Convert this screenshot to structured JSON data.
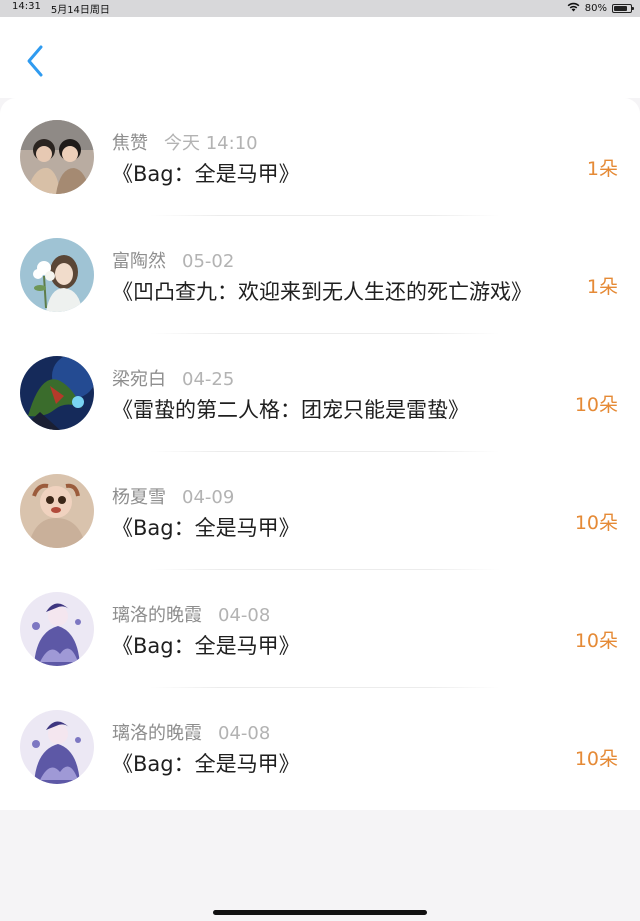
{
  "status_bar": {
    "time": "14:31",
    "date": "5月14日周日",
    "battery": "80%",
    "battery_level": 0.8
  },
  "nav": {
    "back_icon": "chevron-left-icon",
    "accent_color": "#2f9bf0"
  },
  "items": [
    {
      "name": "焦赞",
      "time": "今天 14:10",
      "title": "《Bag：全是马甲》",
      "count": "1朵"
    },
    {
      "name": "富陶然",
      "time": "05-02",
      "title": "《凹凸查九：欢迎来到无人生还的死亡游戏》",
      "count": "1朵"
    },
    {
      "name": "梁宛白",
      "time": "04-25",
      "title": "《雷蛰的第二人格：团宠只能是雷蛰》",
      "count": "10朵"
    },
    {
      "name": "杨夏雪",
      "time": "04-09",
      "title": "《Bag：全是马甲》",
      "count": "10朵"
    },
    {
      "name": "璃洛的晚霞",
      "time": "04-08",
      "title": "《Bag：全是马甲》",
      "count": "10朵"
    },
    {
      "name": "璃洛的晚霞",
      "time": "04-08",
      "title": "《Bag：全是马甲》",
      "count": "10朵"
    }
  ],
  "colors": {
    "count_color": "#e58a36"
  }
}
